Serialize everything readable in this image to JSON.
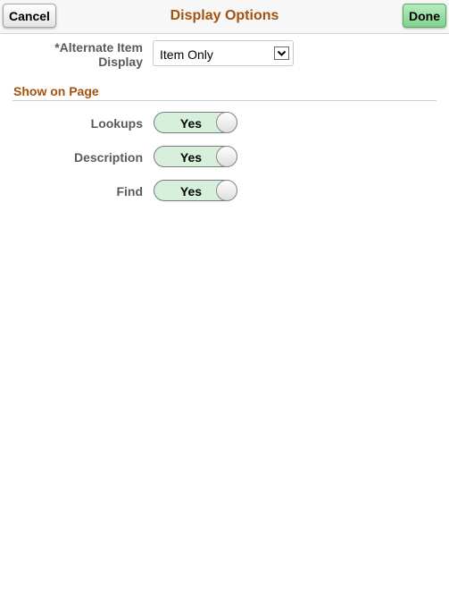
{
  "header": {
    "title": "Display Options",
    "cancel_label": "Cancel",
    "done_label": "Done"
  },
  "alternate_item_display": {
    "label_line1": "*Alternate Item",
    "label_line2": "Display",
    "selected_value": "Item Only"
  },
  "section": {
    "title": "Show on Page",
    "rows": [
      {
        "label": "Lookups",
        "toggle": "Yes"
      },
      {
        "label": "Description",
        "toggle": "Yes"
      },
      {
        "label": "Find",
        "toggle": "Yes"
      }
    ]
  },
  "colors": {
    "title": "#a3520f",
    "toggle_on": "#d6f0db",
    "done_button": "#7fd28c"
  }
}
